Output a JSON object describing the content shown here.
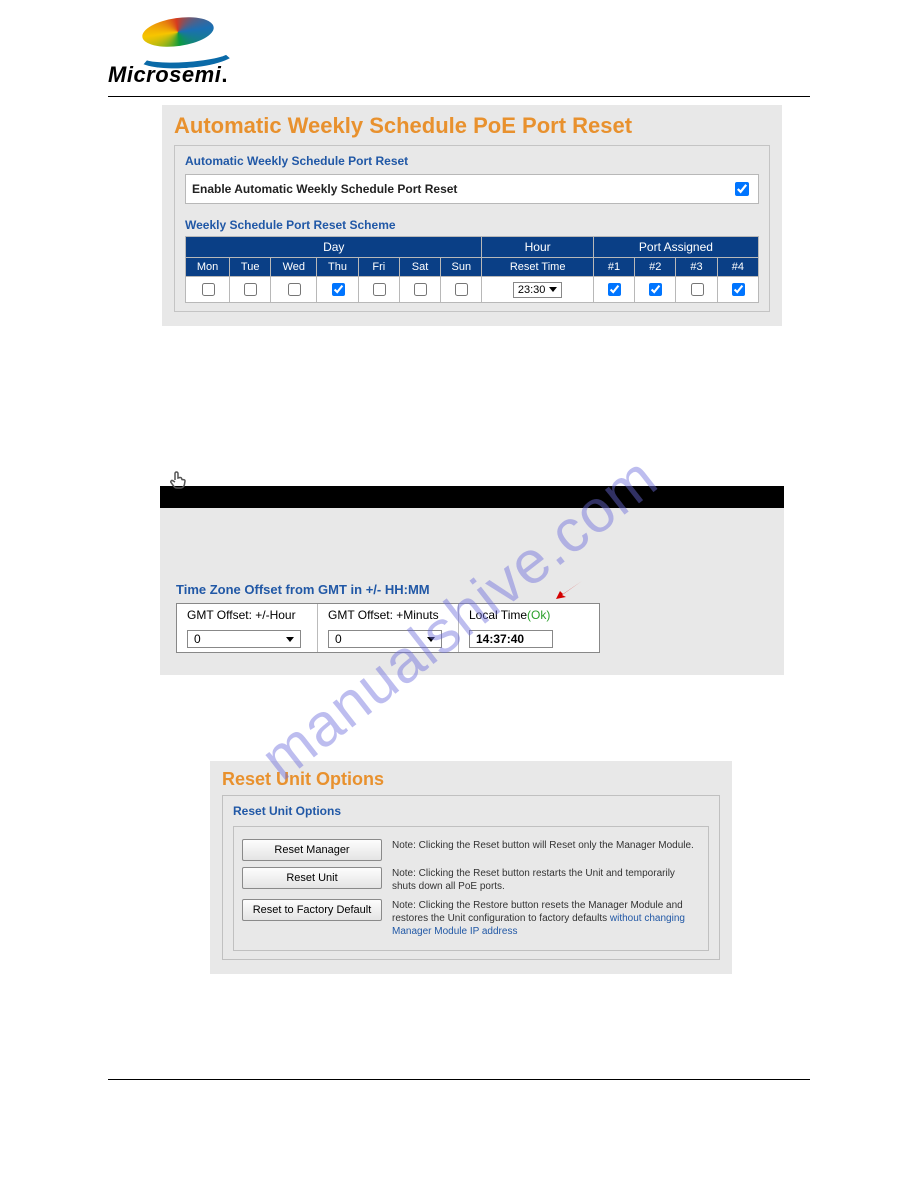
{
  "brand": {
    "name": "Microsemi",
    "dot": "."
  },
  "watermark": "manualshive.com",
  "panel1": {
    "title": "Automatic Weekly Schedule PoE Port Reset",
    "fieldsetLegend": "Automatic Weekly Schedule Port Reset",
    "enableLabel": "Enable Automatic Weekly Schedule Port Reset",
    "enableChecked": true,
    "subLegend": "Weekly Schedule Port Reset Scheme",
    "groupHeaders": {
      "day": "Day",
      "hour": "Hour",
      "ports": "Port Assigned"
    },
    "dayHeaders": [
      "Mon",
      "Tue",
      "Wed",
      "Thu",
      "Fri",
      "Sat",
      "Sun"
    ],
    "hourHeader": "Reset Time",
    "portHeaders": [
      "#1",
      "#2",
      "#3",
      "#4"
    ],
    "daysChecked": [
      false,
      false,
      false,
      true,
      false,
      false,
      false
    ],
    "resetTime": "23:30",
    "portsChecked": [
      true,
      true,
      false,
      true
    ]
  },
  "panel2": {
    "title": "Time Zone Offset from GMT in +/- HH:MM",
    "col1Label": "GMT Offset: +/-Hour",
    "col2Label": "GMT Offset: +Minuts",
    "col3Label": "Local Time",
    "col3Ok": "(Ok)",
    "hourValue": "0",
    "minValue": "0",
    "localTime": "14:37:40"
  },
  "panel3": {
    "title": "Reset Unit Options",
    "legend": "Reset Unit Options",
    "rows": [
      {
        "btn": "Reset Manager",
        "note": "Note: Clicking the Reset button will Reset only the Manager Module."
      },
      {
        "btn": "Reset Unit",
        "note": "Note: Clicking the Reset button restarts the Unit and temporarily shuts down all PoE ports."
      },
      {
        "btn": "Reset to Factory Default",
        "note": "Note: Clicking the Restore button resets the Manager Module and restores the Unit configuration to factory defaults ",
        "link": "without changing Manager Module IP address"
      }
    ]
  }
}
